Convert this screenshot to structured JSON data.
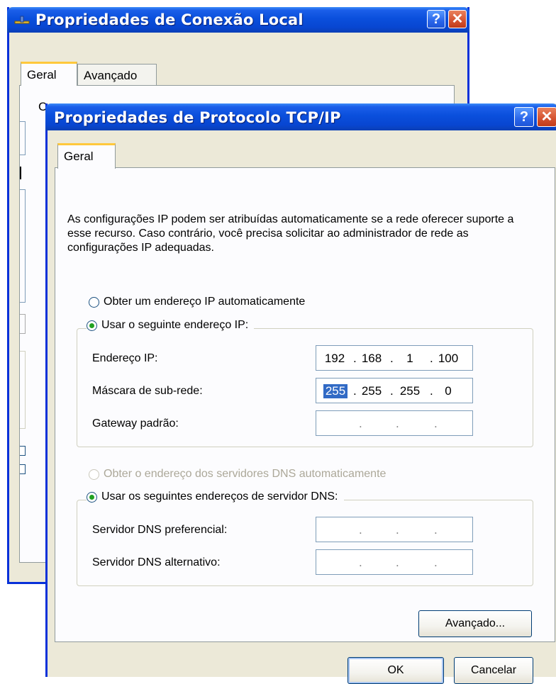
{
  "back_window": {
    "title": "Propriedades de Conexão Local",
    "tabs": [
      {
        "label": "Geral"
      },
      {
        "label": "Avançado"
      }
    ],
    "partial_text": "Co"
  },
  "front_window": {
    "title": "Propriedades de Protocolo TCP/IP",
    "tab": "Geral",
    "description": "As configurações IP podem ser atribuídas automaticamente se a rede oferecer suporte a esse recurso. Caso contrário, você precisa solicitar ao administrador de rede as configurações IP adequadas.",
    "ip_auto_label": "Obter um endereço IP automaticamente",
    "ip_manual_label": "Usar o seguinte endereço IP:",
    "fields": {
      "ip": {
        "label": "Endereço IP:",
        "octets": [
          "192",
          "168",
          "1",
          "100"
        ]
      },
      "mask": {
        "label": "Máscara de sub-rede:",
        "octets": [
          "255",
          "255",
          "255",
          "0"
        ]
      },
      "gateway": {
        "label": "Gateway padrão:",
        "octets": [
          "",
          "",
          "",
          ""
        ]
      }
    },
    "dns_auto_label": "Obter o endereço dos servidores DNS automaticamente",
    "dns_manual_label": "Usar os seguintes endereços de servidor DNS:",
    "dns_fields": {
      "preferred": {
        "label": "Servidor DNS preferencial:",
        "octets": [
          "",
          "",
          "",
          ""
        ]
      },
      "alternate": {
        "label": "Servidor DNS alternativo:",
        "octets": [
          "",
          "",
          "",
          ""
        ]
      }
    },
    "buttons": {
      "advanced": "Avançado...",
      "ok": "OK",
      "cancel": "Cancelar"
    },
    "title_help": "?",
    "title_close": "✕"
  }
}
